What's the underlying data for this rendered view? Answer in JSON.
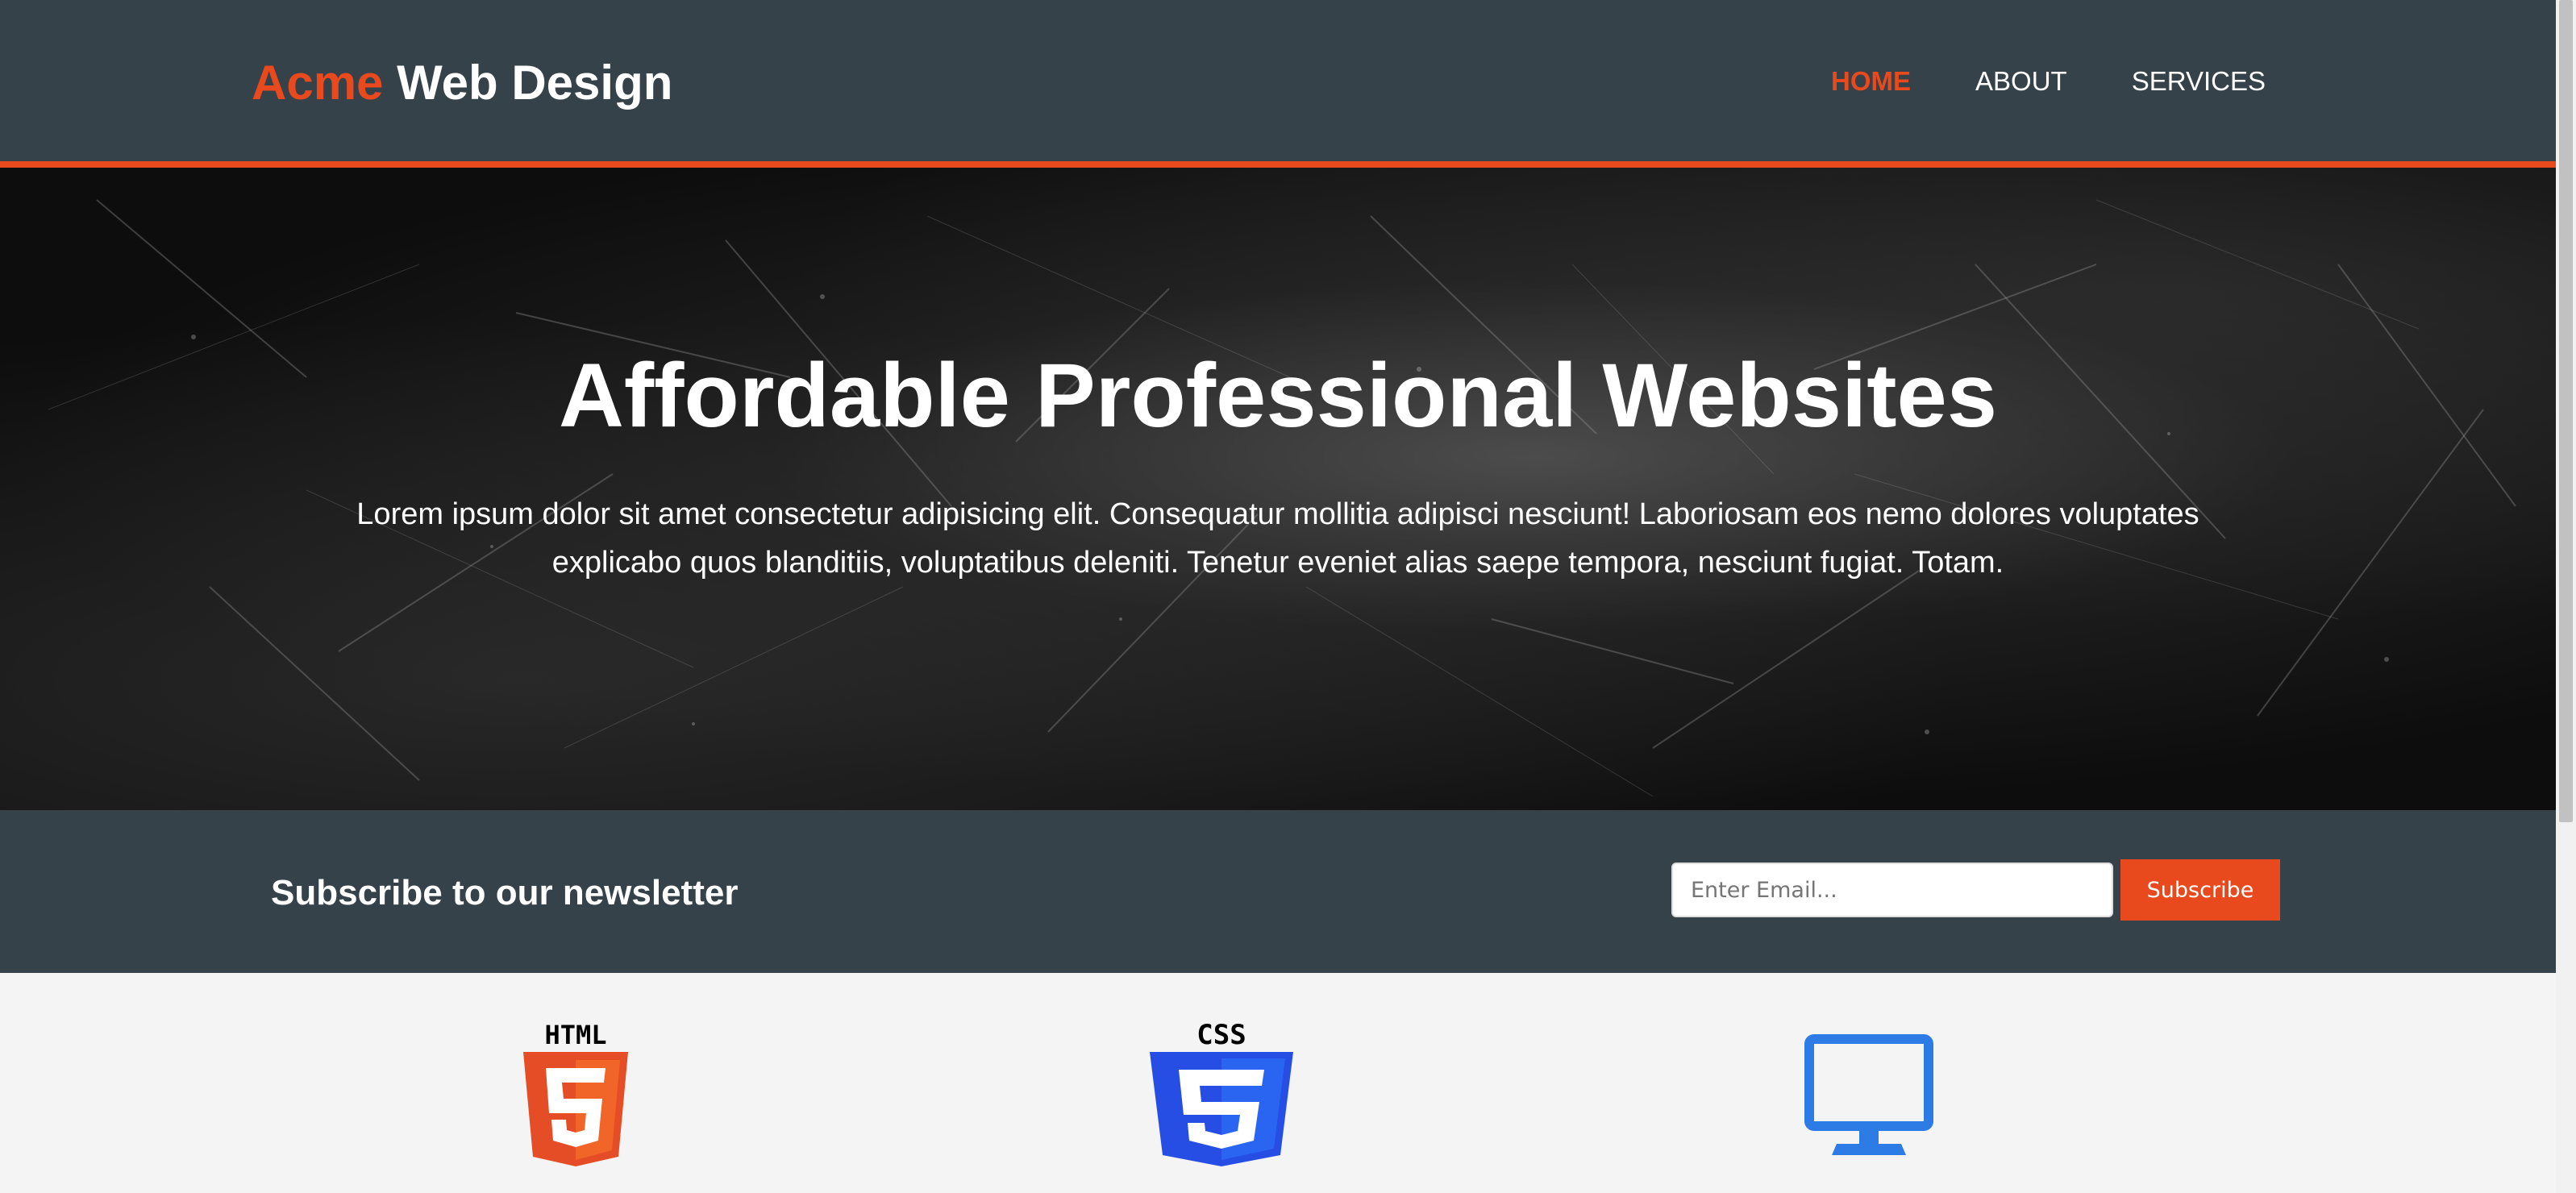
{
  "header": {
    "brand_highlight": "Acme",
    "brand_rest": " Web Design",
    "nav": [
      {
        "label": "HOME",
        "current": true
      },
      {
        "label": "ABOUT",
        "current": false
      },
      {
        "label": "SERVICES",
        "current": false
      }
    ]
  },
  "showcase": {
    "title": "Affordable Professional Websites",
    "text": "Lorem ipsum dolor sit amet consectetur adipisicing elit. Consequatur mollitia adipisci nesciunt! Laboriosam eos nemo dolores voluptates explicabo quos blanditiis, voluptatibus deleniti. Tenetur eveniet alias saepe tempora, nesciunt fugiat. Totam."
  },
  "newsletter": {
    "title": "Subscribe to our newsletter",
    "email_placeholder": "Enter Email...",
    "email_value": "",
    "subscribe_label": "Subscribe"
  },
  "boxes": {
    "icons": [
      {
        "name": "html5-logo-icon",
        "label": "HTML"
      },
      {
        "name": "css3-logo-icon",
        "label": "CSS"
      },
      {
        "name": "monitor-icon"
      }
    ]
  },
  "colors": {
    "accent": "#e8491d",
    "header_bg": "#35424a",
    "page_bg": "#f4f4f4",
    "html5_orange": "#e44d26",
    "css3_blue": "#264de4",
    "monitor_blue": "#2d7be5"
  }
}
